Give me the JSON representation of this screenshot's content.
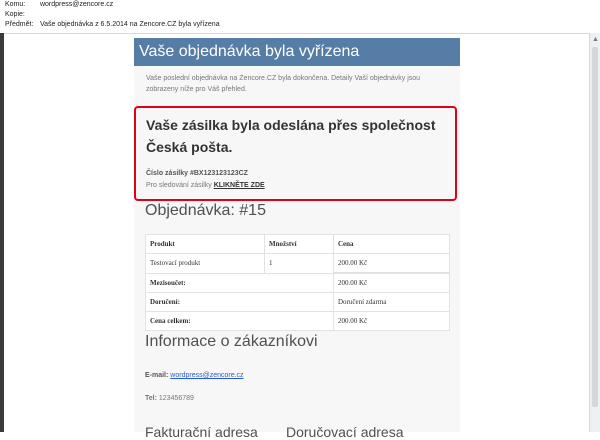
{
  "headers": {
    "to_label": "Komu:",
    "to_value": "wordpress@zencore.cz",
    "cc_label": "Kopie:",
    "cc_value": "",
    "subject_label": "Předmět:",
    "subject_value": "Vaše objednávka z 6.5.2014 na Zencore.CZ byla vyřízena"
  },
  "email": {
    "title": "Vaše objednávka byla vyřízena",
    "intro": "Vaše poslední objednávka na Zencore.CZ byla dokončena. Detaily Vaší objednávky jsou zobrazeny níže pro Váš přehled.",
    "shipping": {
      "heading": "Vaše zásilka byla odeslána přes společnost Česká pošta.",
      "tracking_number_text": "Číslo zásilky #BX123123123CZ",
      "tracking_prefix": "Pro sledování zásilky",
      "tracking_link": "KLIKNĚTE ZDE"
    },
    "order_title": "Objednávka: #15",
    "table": {
      "headers": [
        "Produkt",
        "Množství",
        "Cena"
      ],
      "items": [
        [
          "Testovací produkt",
          "1",
          "200.00 Kč"
        ]
      ],
      "totals": [
        {
          "label": "Mezisoučet:",
          "value": "200.00 Kč"
        },
        {
          "label": "Doručení:",
          "value": "Doručení zdarma"
        },
        {
          "label": "Cena celkem:",
          "value": "200.00 Kč"
        }
      ]
    },
    "customer_title": "Informace o zákazníkovi",
    "email_label": "E-mail:",
    "email_value": "wordpress@zencore.cz",
    "tel_label": "Tel:",
    "tel_value": "123456789",
    "billing_title": "Fakturační adresa",
    "delivery_title": "Doručovací adresa"
  },
  "colors": {
    "title_bar": "#557da5",
    "highlight_border": "#e0001b",
    "link": "#2a5bd7"
  }
}
